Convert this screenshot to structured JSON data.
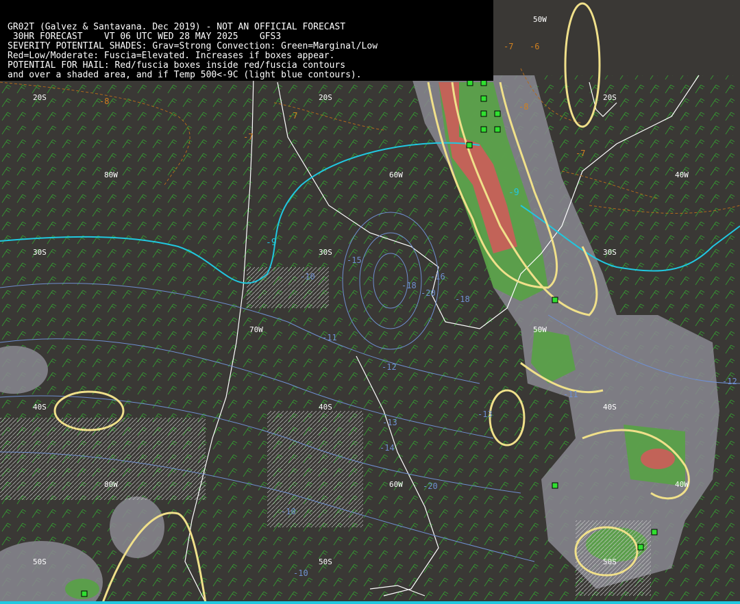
{
  "header": {
    "line1": "GR02T (Galvez & Santavana. Dec 2019) - NOT AN OFFICIAL FORECAST",
    "line2": " 30HR FORECAST    VT 06 UTC WED 28 MAY 2025    GFS3",
    "line3": "SEVERITY POTENTIAL SHADES: Grav=Strong Convection: Green=Marginal/Low",
    "line4": "Red=Low/Moderate: Fuscia=Elevated. Increases if boxes appear.",
    "line5": "POTENTIAL FOR HAIL: Red/fuscia boxes inside red/fuscia contours",
    "line6": "and over a shaded area, and if Temp 500<-9C (light blue contours)."
  },
  "grid_labels": {
    "lat20_left": "20S",
    "lat20_mid": "20S",
    "lat20_right": "20S",
    "lat30_left": "30S",
    "lat30_mid": "30S",
    "lat30_right": "30S",
    "lat40_left": "40S",
    "lat40_mid": "40S",
    "lat40_right": "40S",
    "lat50_left": "50S",
    "lat50_mid": "50S",
    "lat50_right": "50S",
    "lon80_top": "80W",
    "lon80_bot": "80W",
    "lon70_mid": "70W",
    "lon60_top": "60W",
    "lon60_bot": "60W",
    "lon50_top": "50W",
    "lon50_mid": "50W",
    "lon40_top": "40W",
    "lon40_bot": "40W"
  },
  "temp_labels": {
    "t1": "-8",
    "t2": "-7",
    "t3": "-6",
    "t4": "-7",
    "t5": "-8",
    "t6": "-7",
    "t7": "-7",
    "t8": "-9",
    "t9": "-9"
  },
  "blue_labels": {
    "b1": "-10",
    "b2": "-11",
    "b3": "-12",
    "b4": "-13",
    "b5": "-14",
    "b6": "-15",
    "b7": "-16",
    "b8": "-18",
    "b9": "-20",
    "b10": "-18",
    "b11": "-20",
    "b12": "-11",
    "b13": "-12",
    "b14": "-13",
    "b15": "-10",
    "b16": "-10"
  },
  "colors": {
    "background": "#3a3835",
    "coast": "#ffffff",
    "temp500_cyan": "#20c8e0",
    "temp_contour_blue": "#6f8fd0",
    "severity_gray": "#8a8890",
    "severity_green": "#5aa048",
    "severity_red": "#c86058",
    "yellow_contour": "#f0e08a",
    "wind_barb": "#30e030",
    "hail_box": "#30e030"
  },
  "map_layers": [
    "coastlines",
    "wind-barbs",
    "500hPa-temperature",
    "severity-shading",
    "hail-boxes"
  ]
}
